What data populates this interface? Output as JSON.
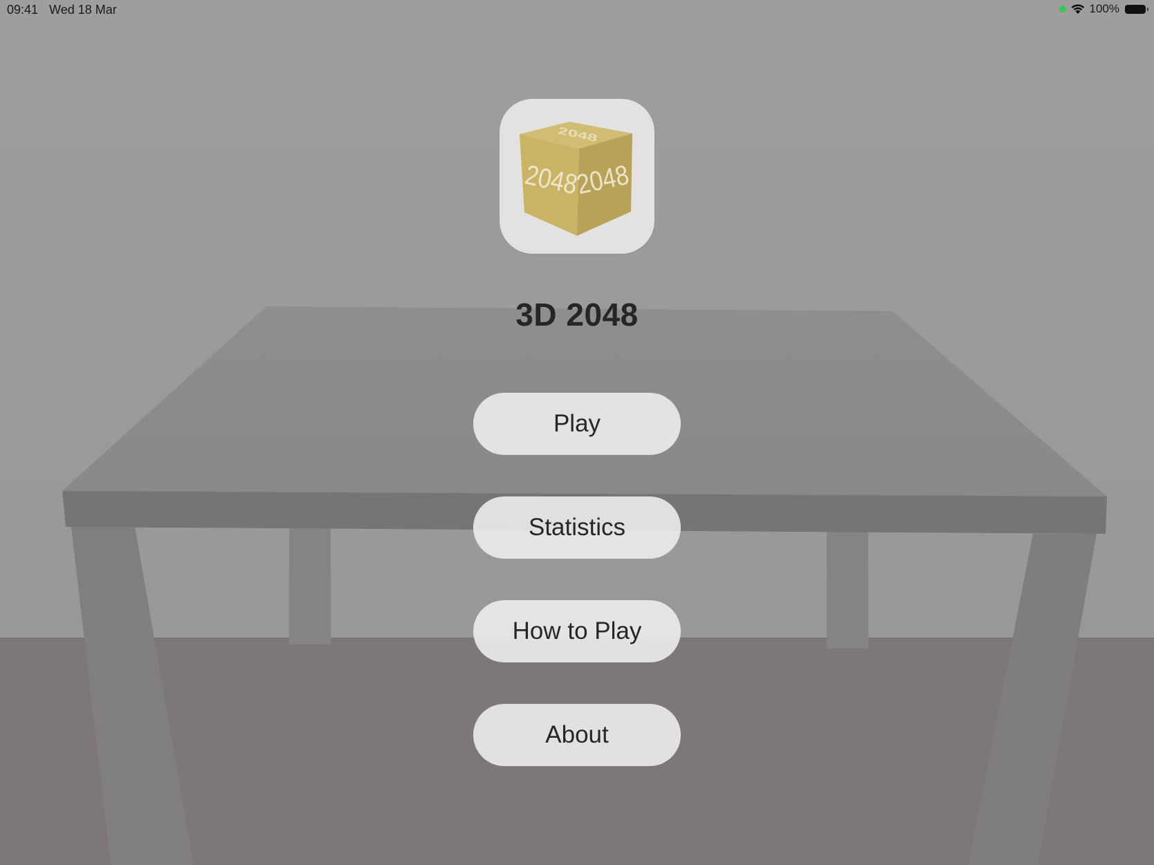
{
  "status_bar": {
    "time": "09:41",
    "date": "Wed 18 Mar",
    "battery_percent": "100%",
    "icons": [
      "camera-indicator-icon",
      "wifi-icon",
      "battery-icon"
    ]
  },
  "app": {
    "title": "3D 2048",
    "icon_face_text": "2048",
    "icon": "cube-2048-icon"
  },
  "menu": {
    "play_label": "Play",
    "statistics_label": "Statistics",
    "how_to_play_label": "How to Play",
    "about_label": "About"
  },
  "colors": {
    "cube_top": "#d0bd73",
    "cube_left": "#c9b466",
    "cube_right": "#b7a257",
    "button_bg": "#ececec",
    "text": "#262626",
    "camera_dot": "#35c759"
  }
}
